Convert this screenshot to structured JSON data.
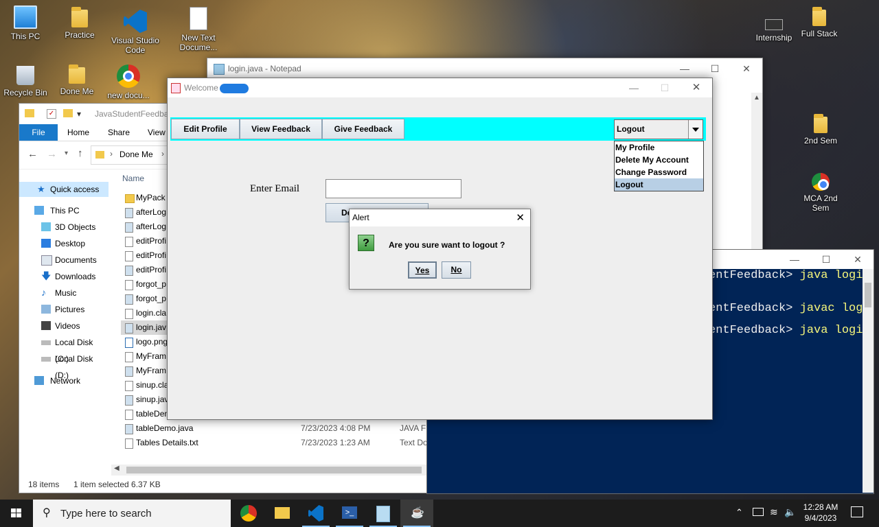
{
  "desktop": {
    "icons": [
      {
        "label": "This PC",
        "icon": "computer-icon"
      },
      {
        "label": "Practice",
        "icon": "folder-icon"
      },
      {
        "label": "Visual Studio Code",
        "icon": "vscode-icon"
      },
      {
        "label": "New Text Docume...",
        "icon": "text-document-icon"
      },
      {
        "label": "Recycle Bin",
        "icon": "recycle-bin-icon"
      },
      {
        "label": "Done Me",
        "icon": "folder-icon"
      },
      {
        "label": "new docu...",
        "icon": "chrome-icon"
      },
      {
        "label": "Internship",
        "icon": "chip-icon"
      },
      {
        "label": "Full Stack",
        "icon": "folder-icon"
      },
      {
        "label": "2nd Sem",
        "icon": "folder-icon"
      },
      {
        "label": "MCA 2nd Sem",
        "icon": "chrome-icon"
      }
    ]
  },
  "notepad": {
    "title": "login.java - Notepad"
  },
  "explorer": {
    "qat_title": "JavaStudentFeedba",
    "ribbon": {
      "file": "File",
      "home": "Home",
      "share": "Share",
      "view": "View"
    },
    "address": "Done Me",
    "nav": [
      {
        "label": "Quick access",
        "icon": "star-icon"
      },
      {
        "label": "This PC",
        "icon": "computer-icon"
      },
      {
        "label": "3D Objects",
        "icon": "cube-icon"
      },
      {
        "label": "Desktop",
        "icon": "desktop-icon"
      },
      {
        "label": "Documents",
        "icon": "document-icon"
      },
      {
        "label": "Downloads",
        "icon": "download-icon"
      },
      {
        "label": "Music",
        "icon": "music-icon"
      },
      {
        "label": "Pictures",
        "icon": "picture-icon"
      },
      {
        "label": "Videos",
        "icon": "video-icon"
      },
      {
        "label": "Local Disk (C:)",
        "icon": "drive-icon"
      },
      {
        "label": "Local Disk (D:)",
        "icon": "drive-icon"
      },
      {
        "label": "Network",
        "icon": "network-icon"
      }
    ],
    "column_name": "Name",
    "files": [
      {
        "name": "MyPack",
        "date": "",
        "type": ""
      },
      {
        "name": "afterLog",
        "date": "",
        "type": ""
      },
      {
        "name": "afterLog",
        "date": "",
        "type": ""
      },
      {
        "name": "editProfi",
        "date": "",
        "type": ""
      },
      {
        "name": "editProfi",
        "date": "",
        "type": ""
      },
      {
        "name": "editProfi",
        "date": "",
        "type": ""
      },
      {
        "name": "forgot_p",
        "date": "",
        "type": ""
      },
      {
        "name": "forgot_p",
        "date": "",
        "type": ""
      },
      {
        "name": "login.cla",
        "date": "",
        "type": ""
      },
      {
        "name": "login.jav",
        "date": "",
        "type": ""
      },
      {
        "name": "logo.png",
        "date": "",
        "type": ""
      },
      {
        "name": "MyFram",
        "date": "",
        "type": ""
      },
      {
        "name": "MyFram",
        "date": "",
        "type": ""
      },
      {
        "name": "sinup.cla",
        "date": "",
        "type": ""
      },
      {
        "name": "sinup.jav",
        "date": "",
        "type": ""
      },
      {
        "name": "tableDem",
        "date": "",
        "type": ""
      },
      {
        "name": "tableDemo.java",
        "date": "7/23/2023 4:08 PM",
        "type": "JAVA Fi"
      },
      {
        "name": "Tables Details.txt",
        "date": "7/23/2023 1:23 AM",
        "type": "Text Do"
      }
    ],
    "status": {
      "items": "18 items",
      "selected": "1 item selected  6.37 KB"
    }
  },
  "powershell": {
    "lines": [
      {
        "prompt": "entFeedback>",
        "cmd": "java logi"
      },
      {
        "prompt": "entFeedback>",
        "cmd": "javac log"
      },
      {
        "prompt": "entFeedback>",
        "cmd": "java logi"
      }
    ]
  },
  "java_frame": {
    "title": "Welcome",
    "toolbar": {
      "edit_profile": "Edit Profile",
      "view_feedback": "View Feedback",
      "give_feedback": "Give Feedback"
    },
    "combo": {
      "value": "Logout",
      "options": [
        "My Profile",
        "Delete My Account",
        "Change Password",
        "Logout"
      ]
    },
    "email_label": "Enter Email",
    "delete_button": "De",
    "bar_color": "#00ffff"
  },
  "alert": {
    "title": "Alert",
    "message": "Are you sure want to logout ?",
    "yes": "Yes",
    "no": "No",
    "icon": "question-icon"
  },
  "taskbar": {
    "search_placeholder": "Type here to search",
    "apps": [
      "chrome-icon",
      "file-explorer-icon",
      "vscode-icon",
      "powershell-icon",
      "notepad-icon",
      "java-icon"
    ],
    "time": "12:28 AM",
    "date": "9/4/2023"
  }
}
